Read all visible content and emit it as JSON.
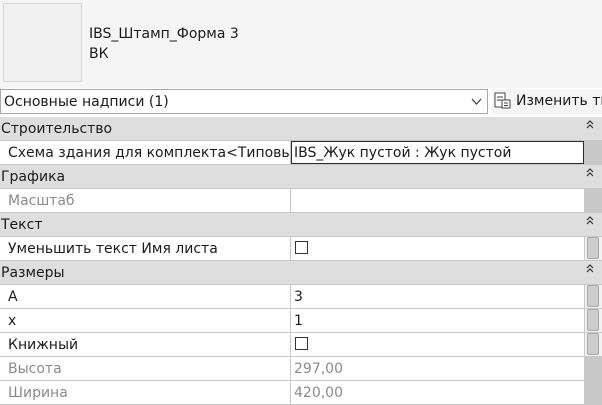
{
  "header": {
    "family_name": "IBS_Штамп_Форма 3",
    "type_name": "ВК",
    "preview_icon": "type-preview-thumbnail"
  },
  "selector": {
    "value": "Основные надписи (1)",
    "dropdown_icon": "chevron-down-icon"
  },
  "edit_type": {
    "label": "Изменить тип",
    "icon": "edit-type-icon"
  },
  "groups": {
    "construction": {
      "label": "Строительство",
      "building_scheme": {
        "name": "Схема здания для комплекта<Типовые...",
        "value": "IBS_Жук пустой : Жук пустой"
      }
    },
    "graphics": {
      "label": "Графика",
      "scale": {
        "name": "Масштаб",
        "value": ""
      }
    },
    "text": {
      "label": "Текст",
      "reduce_text": {
        "name": "Уменьшить текст Имя листа",
        "checked": false
      }
    },
    "dimensions": {
      "label": "Размеры",
      "a": {
        "name": "А",
        "value": "3"
      },
      "x": {
        "name": "х",
        "value": "1"
      },
      "portrait": {
        "name": "Книжный",
        "checked": false
      },
      "height": {
        "name": "Высота",
        "value": "297,00"
      },
      "width": {
        "name": "Ширина",
        "value": "420,00"
      }
    }
  },
  "colors": {
    "group_header_bg": "#dedede",
    "grid_line": "#c8c8c8",
    "readonly_text": "#8a8a8a"
  }
}
